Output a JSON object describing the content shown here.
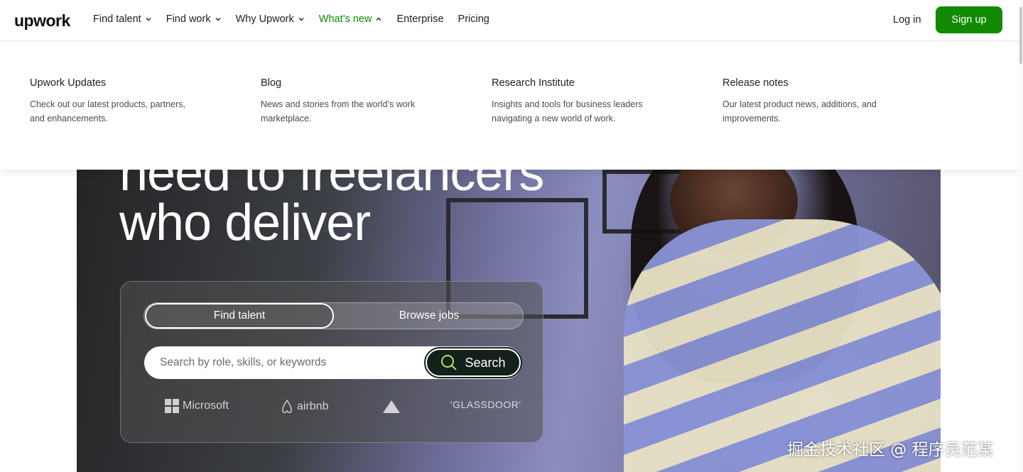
{
  "header": {
    "logo": "upwork",
    "nav": [
      {
        "label": "Find talent",
        "has_chevron": true,
        "active": false
      },
      {
        "label": "Find work",
        "has_chevron": true,
        "active": false
      },
      {
        "label": "Why Upwork",
        "has_chevron": true,
        "active": false
      },
      {
        "label": "What’s new",
        "has_chevron": true,
        "active": true
      },
      {
        "label": "Enterprise",
        "has_chevron": false,
        "active": false
      },
      {
        "label": "Pricing",
        "has_chevron": false,
        "active": false
      }
    ],
    "login_label": "Log in",
    "signup_label": "Sign up"
  },
  "dropdown": {
    "columns": [
      {
        "title": "Upwork Updates",
        "description": "Check out our latest products, partners, and enhancements."
      },
      {
        "title": "Blog",
        "description": "News and stories from the world’s work marketplace."
      },
      {
        "title": "Research Institute",
        "description": "Insights and tools for business leaders navigating a new world of work."
      },
      {
        "title": "Release notes",
        "description": "Our latest product news, additions, and improvements."
      }
    ]
  },
  "hero": {
    "title_line1": "need to freelancers",
    "title_line2": "who deliver",
    "toggle": {
      "active_label": "Find talent",
      "inactive_label": "Browse jobs"
    },
    "search": {
      "placeholder": "Search by role, skills, or keywords",
      "button_label": "Search"
    },
    "trusted_logos": [
      "Microsoft",
      "airbnb",
      "",
      "'GLASSDOOR'"
    ]
  },
  "watermark": "掘金技术社区 @ 程序员范某",
  "colors": {
    "brand_green": "#108a00",
    "search_button": "#14201a",
    "active_nav": "#108a00"
  },
  "icons": [
    "chevron-down-icon",
    "chevron-up-icon",
    "search-icon",
    "microsoft-logo",
    "airbnb-logo",
    "bissell-logo",
    "glassdoor-logo"
  ]
}
